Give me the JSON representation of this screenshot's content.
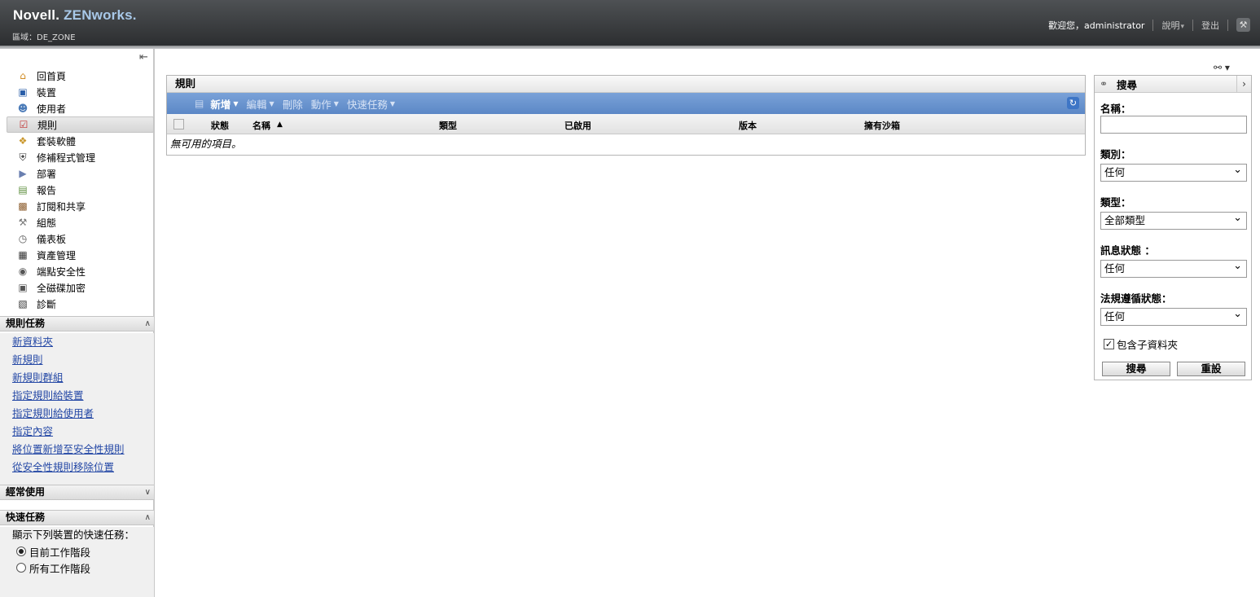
{
  "header": {
    "brand_novell": "Novell.",
    "brand_zenworks": "ZENworks.",
    "zone": "區域：DE_ZONE",
    "welcome": "歡迎您，administrator",
    "help": "說明",
    "logout": "登出"
  },
  "nav": {
    "items": [
      {
        "label": "回首頁",
        "icon": "home-icon"
      },
      {
        "label": "裝置",
        "icon": "monitor-icon"
      },
      {
        "label": "使用者",
        "icon": "users-icon"
      },
      {
        "label": "規則",
        "icon": "policy-icon"
      },
      {
        "label": "套裝軟體",
        "icon": "bundle-icon"
      },
      {
        "label": "修補程式管理",
        "icon": "shield-icon"
      },
      {
        "label": "部署",
        "icon": "deploy-icon"
      },
      {
        "label": "報告",
        "icon": "report-icon"
      },
      {
        "label": "訂閱和共享",
        "icon": "subscription-icon"
      },
      {
        "label": "組態",
        "icon": "wrench-icon"
      },
      {
        "label": "儀表板",
        "icon": "gauge-icon"
      },
      {
        "label": "資產管理",
        "icon": "asset-icon"
      },
      {
        "label": "端點安全性",
        "icon": "lock-icon"
      },
      {
        "label": "全磁碟加密",
        "icon": "disk-icon"
      },
      {
        "label": "診斷",
        "icon": "diagnostics-icon"
      }
    ],
    "active_index": 3
  },
  "tasks": {
    "title": "規則任務",
    "links": [
      "新資料夾",
      "新規則",
      "新規則群組",
      "指定規則給裝置",
      "指定規則給使用者",
      "指定內容",
      "將位置新增至安全性規則",
      "從安全性規則移除位置"
    ]
  },
  "frequent": {
    "title": "經常使用"
  },
  "quick": {
    "title": "快速任務",
    "label": "顯示下列裝置的快速任務：",
    "options": [
      "目前工作階段",
      "所有工作階段"
    ],
    "selected": 0
  },
  "panel": {
    "title": "規則",
    "toolbar": {
      "new": "新增",
      "edit": "編輯",
      "delete": "刪除",
      "action": "動作",
      "quick_tasks": "快速任務"
    },
    "columns": [
      "狀態",
      "名稱",
      "類型",
      "已啟用",
      "版本",
      "擁有沙箱"
    ],
    "sort_indicator": "▲",
    "empty": "無可用的項目。"
  },
  "search": {
    "title": "搜尋",
    "name_label": "名稱：",
    "name_value": "",
    "category_label": "類別：",
    "category_value": "任何",
    "type_label": "類型：",
    "type_value": "全部類型",
    "msg_label": "訊息狀態 ：",
    "msg_value": "任何",
    "compliance_label": "法規遵循狀態：",
    "compliance_value": "任何",
    "include_subfolders": "包含子資料夾",
    "include_checked": true,
    "search_button": "搜尋",
    "reset_button": "重設"
  }
}
